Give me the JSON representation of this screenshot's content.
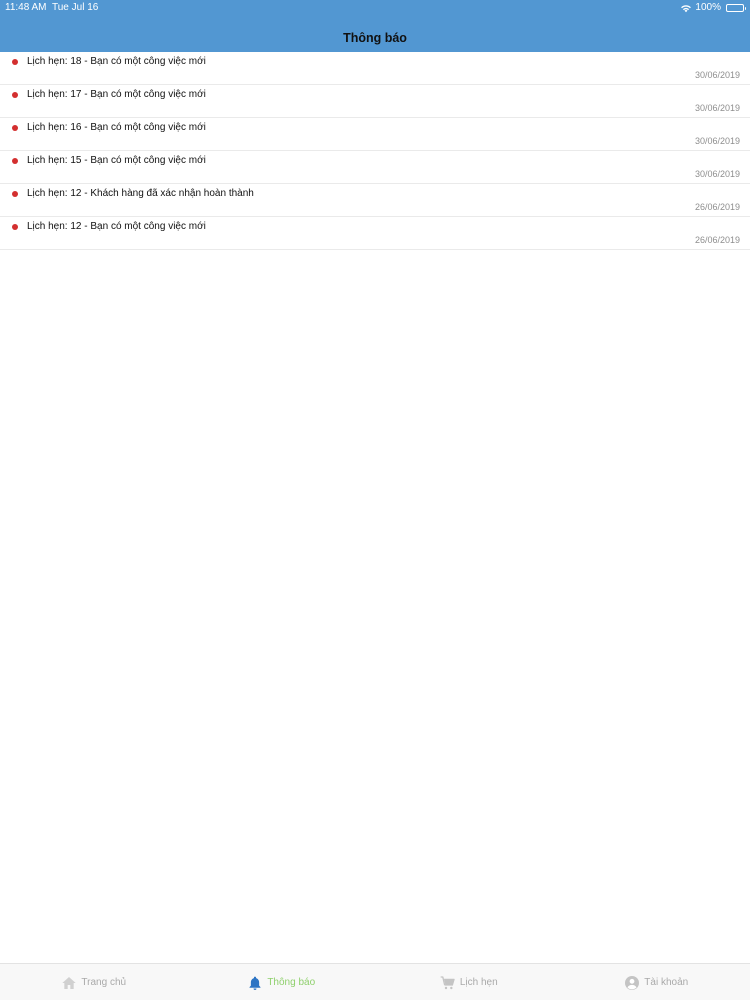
{
  "status_bar": {
    "time": "11:48 AM",
    "date": "Tue Jul 16",
    "battery": "100%"
  },
  "header": {
    "title": "Thông báo"
  },
  "notifications": [
    {
      "text": "Lịch hẹn: 18 - Bạn có một công việc mới",
      "date": "30/06/2019"
    },
    {
      "text": "Lịch hẹn: 17 - Bạn có một công việc mới",
      "date": "30/06/2019"
    },
    {
      "text": "Lịch hẹn: 16 - Bạn có một công việc mới",
      "date": "30/06/2019"
    },
    {
      "text": "Lịch hẹn: 15 - Bạn có một công việc mới",
      "date": "30/06/2019"
    },
    {
      "text": "Lịch hẹn: 12 - Khách hàng đã xác nhận hoàn thành",
      "date": "26/06/2019"
    },
    {
      "text": "Lịch hẹn: 12 - Bạn có một công việc mới",
      "date": "26/06/2019"
    }
  ],
  "tabs": [
    {
      "label": "Trang chủ",
      "icon": "home-icon"
    },
    {
      "label": "Thông báo",
      "icon": "bell-icon"
    },
    {
      "label": "Lịch hẹn",
      "icon": "cart-icon"
    },
    {
      "label": "Tài khoản",
      "icon": "user-icon"
    }
  ],
  "colors": {
    "header_bg": "#5297d2",
    "unread_dot": "#d32f2f",
    "active_tab_label": "#8fd06d",
    "active_tab_icon": "#2d74c4",
    "inactive_tab": "#c4c4c4"
  }
}
